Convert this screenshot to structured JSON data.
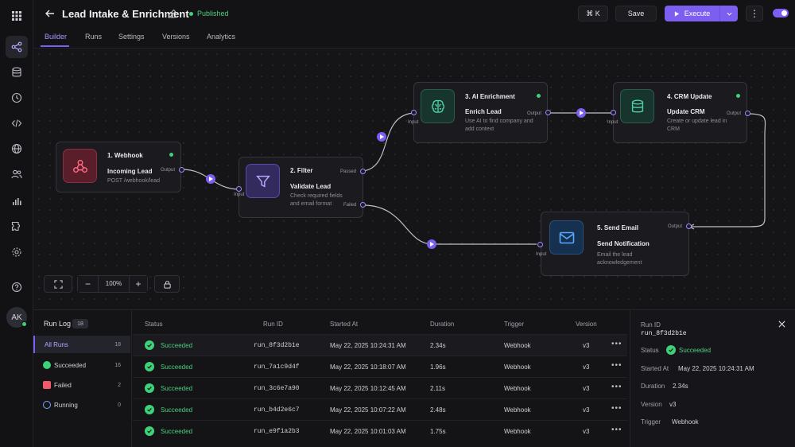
{
  "header": {
    "title": "Lead Intake & Enrichment",
    "status": "Published",
    "shortcut": "⌘ K",
    "save_label": "Save",
    "execute_label": "Execute"
  },
  "tabs": [
    {
      "label": "Builder",
      "active": true
    },
    {
      "label": "Runs"
    },
    {
      "label": "Settings"
    },
    {
      "label": "Versions"
    },
    {
      "label": "Analytics"
    }
  ],
  "rail": {
    "items": [
      "apps-grid-icon",
      "workflow-icon",
      "database-icon",
      "history-icon",
      "code-icon",
      "globe-icon",
      "users-icon",
      "analytics-icon",
      "integrations-icon",
      "settings-icon",
      "help-icon"
    ],
    "avatar": "AK"
  },
  "nodes": [
    {
      "title": "1. Webhook",
      "subtitle": "Incoming Lead",
      "desc": "POST /webhook/lead",
      "output": "Output"
    },
    {
      "title": "2. Filter",
      "subtitle": "Validate Lead",
      "desc": "Check required fields and email format",
      "input": "Input",
      "out_pass": "Passed",
      "out_fail": "Failed"
    },
    {
      "title": "3. AI Enrichment",
      "subtitle": "Enrich Lead",
      "desc": "Use AI to find company and add context",
      "input": "Input",
      "output": "Output"
    },
    {
      "title": "4. CRM Update",
      "subtitle": "Update CRM",
      "desc": "Create or update lead in CRM",
      "input": "Input",
      "output": "Output"
    },
    {
      "title": "5. Send Email",
      "subtitle": "Send Notification",
      "desc": "Email the lead acknowledgement",
      "input": "Input",
      "output": "Output"
    }
  ],
  "zoom": {
    "level": "100%"
  },
  "runlog": {
    "title": "Run Log",
    "count": "18",
    "filters": [
      {
        "label": "All Runs",
        "count": "18"
      },
      {
        "label": "Succeeded",
        "count": "16"
      },
      {
        "label": "Failed",
        "count": "2"
      },
      {
        "label": "Running",
        "count": "0"
      }
    ],
    "columns": [
      "Status",
      "Run ID",
      "Started At",
      "Duration",
      "Trigger",
      "Version"
    ],
    "rows": [
      {
        "status": "Succeeded",
        "run_id": "run_8f3d2b1e",
        "started": "May 22, 2025 10:24:31 AM",
        "duration": "2.34s",
        "trigger": "Webhook",
        "version": "v3"
      },
      {
        "status": "Succeeded",
        "run_id": "run_7a1c9d4f",
        "started": "May 22, 2025 10:18:07 AM",
        "duration": "1.96s",
        "trigger": "Webhook",
        "version": "v3"
      },
      {
        "status": "Succeeded",
        "run_id": "run_3c6e7a90",
        "started": "May 22, 2025 10:12:45 AM",
        "duration": "2.11s",
        "trigger": "Webhook",
        "version": "v3"
      },
      {
        "status": "Succeeded",
        "run_id": "run_b4d2e6c7",
        "started": "May 22, 2025 10:07:22 AM",
        "duration": "2.48s",
        "trigger": "Webhook",
        "version": "v3"
      },
      {
        "status": "Succeeded",
        "run_id": "run_e9f1a2b3",
        "started": "May 22, 2025 10:01:03 AM",
        "duration": "1.75s",
        "trigger": "Webhook",
        "version": "v3"
      }
    ]
  },
  "detail": {
    "run_id_label": "Run ID",
    "run_id": "run_8f3d2b1e",
    "status_label": "Status",
    "status": "Succeeded",
    "started_label": "Started At",
    "started": "May 22, 2025 10:24:31 AM",
    "duration_label": "Duration",
    "duration": "2.34s",
    "version_label": "Version",
    "version": "v3",
    "trigger_label": "Trigger",
    "trigger": "Webhook"
  },
  "colors": {
    "accent": "#7c5ff0",
    "success": "#3fd07a",
    "danger": "#f05a6b"
  }
}
